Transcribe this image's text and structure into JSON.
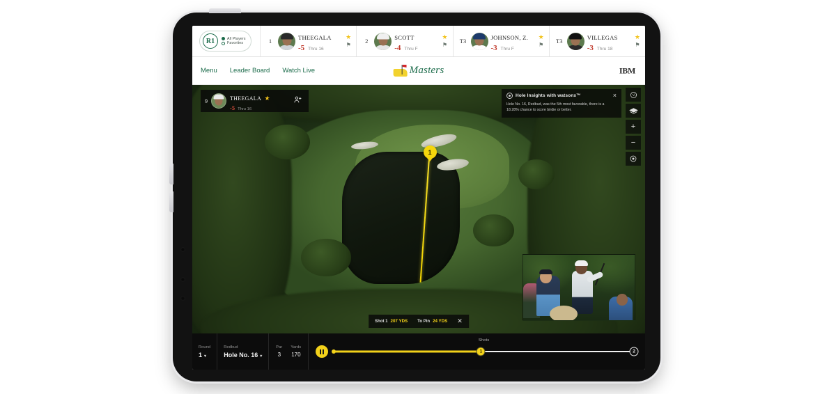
{
  "leaderboard": {
    "round_filter": {
      "badge": "R1",
      "options": [
        {
          "label": "All Players",
          "selected": true
        },
        {
          "label": "Favorites",
          "selected": false
        }
      ]
    },
    "players": [
      {
        "pos": "1",
        "name": "THEEGALA",
        "score": "-5",
        "thru": "Thru 16",
        "star": "★",
        "flag": "⚑",
        "cap": "#2a2a2a",
        "shirt": "#cfd4d8"
      },
      {
        "pos": "2",
        "name": "SCOTT",
        "score": "-4",
        "thru": "Thru F",
        "star": "★",
        "flag": "⚑",
        "cap": "#f0f0f0",
        "shirt": "#e6e6e6"
      },
      {
        "pos": "T3",
        "name": "JOHNSON, Z.",
        "score": "-3",
        "thru": "Thru F",
        "star": "★",
        "flag": "⚑",
        "cap": "#1d3a6b",
        "shirt": "#ffffff"
      },
      {
        "pos": "T3",
        "name": "VILLEGAS",
        "score": "-3",
        "thru": "Thru 18",
        "star": "★",
        "flag": "⚑",
        "cap": "#111111",
        "shirt": "#2a2a2a"
      }
    ]
  },
  "nav": {
    "links": [
      "Menu",
      "Leader Board",
      "Watch Live"
    ],
    "brand": "Masters",
    "sponsor": "IBM"
  },
  "stage": {
    "player_card": {
      "pos": "9",
      "name": "THEEGALA",
      "star": "★",
      "score": "-5",
      "thru": "Thru 16",
      "add_icon": "⚬"
    },
    "insight": {
      "title": "Hole Insights with watsonx™",
      "body": "Hole No. 16, Redbud, was the 5th most favorable, there is a 18.28% chance to score birdie or better.",
      "close": "×"
    },
    "map_controls": [
      {
        "name": "golf-ball",
        "glyph": "⚽"
      },
      {
        "name": "layers",
        "glyph": "◇"
      },
      {
        "name": "zoom-in",
        "glyph": "+"
      },
      {
        "name": "zoom-out",
        "glyph": "−"
      },
      {
        "name": "locate",
        "glyph": "◎"
      }
    ],
    "shot_marker": "1",
    "shot_info": {
      "shot_label": "Shot 1",
      "shot_value": "207 YDS",
      "pin_label": "To Pin",
      "pin_value": "24 YDS",
      "close": "✕"
    }
  },
  "bottombar": {
    "round_label": "Round",
    "round_value": "1",
    "course_label": "Redbud",
    "course_value": "Hole No. 16",
    "par_label": "Par",
    "par_value": "3",
    "yards_label": "Yards",
    "yards_value": "170",
    "caret": "▾",
    "timeline_label": "Shots",
    "nodes": [
      "1",
      "2"
    ]
  }
}
